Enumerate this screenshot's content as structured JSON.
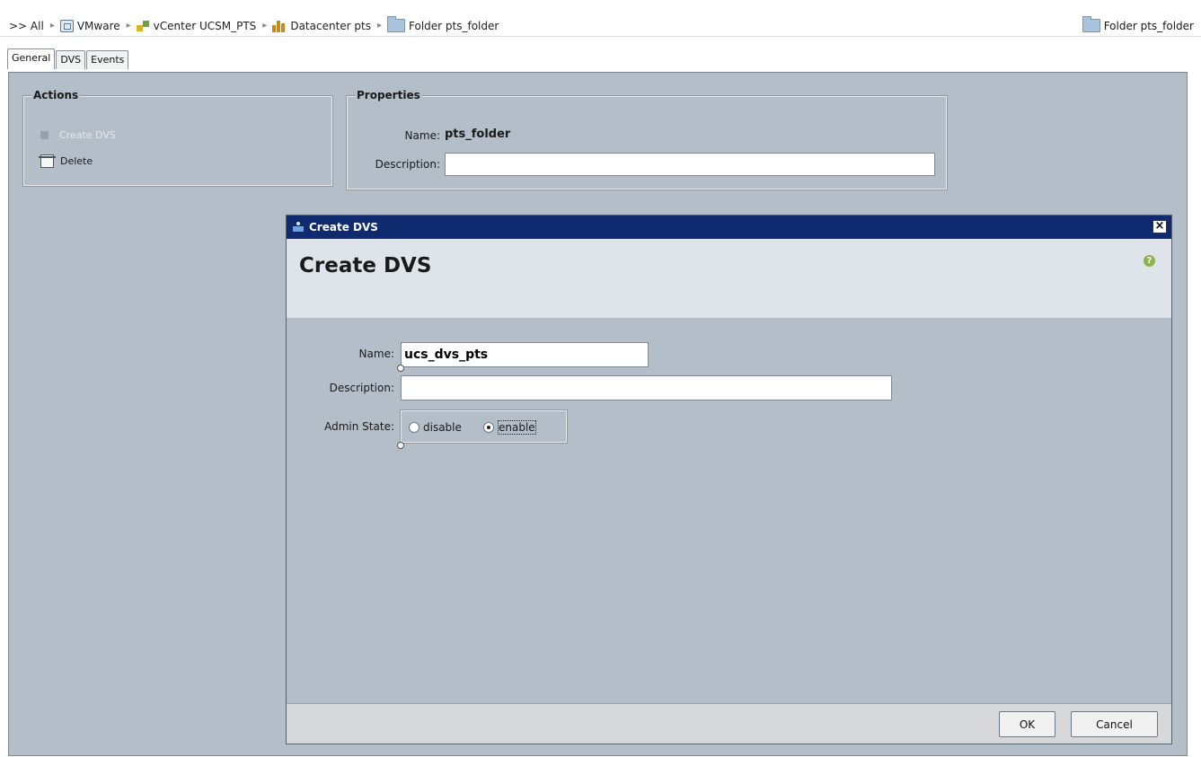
{
  "breadcrumb": {
    "prefix": ">> All",
    "items": [
      {
        "label": "VMware",
        "icon": "vmware-icon"
      },
      {
        "label": "vCenter UCSM_PTS",
        "icon": "vcenter-icon"
      },
      {
        "label": "Datacenter pts",
        "icon": "datacenter-icon"
      },
      {
        "label": "Folder pts_folder",
        "icon": "folder-icon"
      }
    ],
    "current": "Folder pts_folder"
  },
  "tabs": [
    "General",
    "DVS",
    "Events"
  ],
  "actions": {
    "title": "Actions",
    "items": [
      {
        "label": "Create DVS",
        "icon": "create-dvs-icon",
        "enabled": false
      },
      {
        "label": "Delete",
        "icon": "delete-icon",
        "enabled": true
      }
    ]
  },
  "properties": {
    "title": "Properties",
    "name_label": "Name:",
    "name_value": "pts_folder",
    "description_label": "Description:",
    "description_value": ""
  },
  "dialog": {
    "title": "Create DVS",
    "heading": "Create DVS",
    "help_icon": "help-icon",
    "name_label": "Name:",
    "name_value": "ucs_dvs_pts",
    "description_label": "Description:",
    "description_value": "",
    "admin_state_label": "Admin State:",
    "admin_state_options": [
      "disable",
      "enable"
    ],
    "admin_state_selected": "enable",
    "ok_label": "OK",
    "cancel_label": "Cancel"
  },
  "colors": {
    "panel_bg": "#b4bec9",
    "title_bar": "#0f2a6e",
    "dialog_header": "#dfe4ea"
  }
}
